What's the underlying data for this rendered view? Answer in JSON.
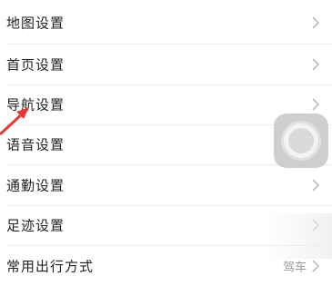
{
  "settings": {
    "items": [
      {
        "label": "地图设置",
        "value": ""
      },
      {
        "label": "首页设置",
        "value": ""
      },
      {
        "label": "导航设置",
        "value": ""
      },
      {
        "label": "语音设置",
        "value": ""
      },
      {
        "label": "通勤设置",
        "value": ""
      },
      {
        "label": "足迹设置",
        "value": ""
      },
      {
        "label": "常用出行方式",
        "value": "驾车"
      }
    ]
  },
  "overlay": {
    "assistive_touch_icon": "assistive-touch-icon",
    "annotation_arrow_color": "#e53935"
  },
  "colors": {
    "background": "#ffffff",
    "label_text": "#222222",
    "value_text": "#999999",
    "chevron": "#b5b5b5",
    "divider": "#ececec"
  }
}
